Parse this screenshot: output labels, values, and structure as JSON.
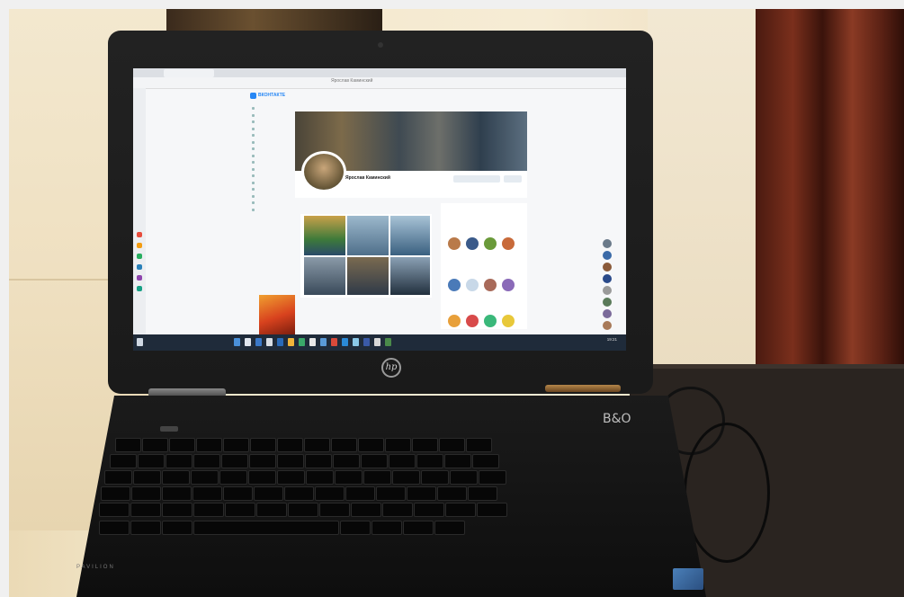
{
  "browser": {
    "tab_title": "Ярослав Каминский",
    "address": "Ярослав Каминский"
  },
  "vk": {
    "logo_text": "ВКОНТАКТЕ",
    "profile_name": "Ярослав Каминский"
  },
  "taskbar": {
    "time": "19:21"
  },
  "laptop": {
    "brand_logo": "hp",
    "deck_logo": "B&O",
    "model_text": "PAVILION"
  },
  "colors": {
    "vk_accent": "#2787f5",
    "taskbar": "#1f2b3a",
    "curtain": "#5a2114"
  },
  "icons": [
    "hp-logo-icon",
    "vk-logo-icon",
    "webcam-icon",
    "power-button-icon"
  ]
}
